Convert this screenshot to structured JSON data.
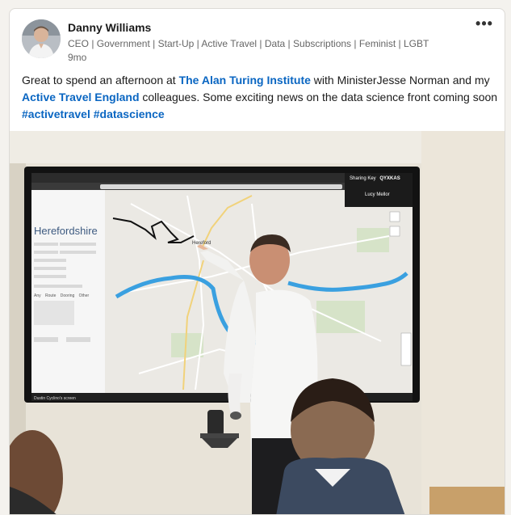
{
  "post": {
    "author": {
      "name": "Danny Williams",
      "headline": "CEO | Government | Start-Up | Active Travel | Data | Subscriptions | Feminist | LGBT",
      "time": "9mo"
    },
    "more_menu_label": "•••",
    "text": {
      "part1": "Great to spend an afternoon at ",
      "link1": "The Alan Turing Institute",
      "part2": " with MinisterJesse Norman and my ",
      "link2": "Active Travel England",
      "part3": " colleagues. Some exciting news on the data science front coming soon ",
      "hashtag1": "#activetravel",
      "hashtag2": "#datascience"
    }
  },
  "photo_screen": {
    "sidebar_title": "Herefordshire",
    "map_place_label": "Hereford",
    "sharing_key_label": "Sharing Key",
    "sharing_key_value": "QYXKAS",
    "user_label": "Lucy Mellor",
    "taskbar_label": "Dustin Cyclino's screen",
    "radio_options": [
      "Any",
      "Route",
      "Dooring",
      "Other"
    ]
  },
  "colors": {
    "link": "#0a66c2",
    "river": "#3aa0e0",
    "map_bg": "#ececea"
  }
}
